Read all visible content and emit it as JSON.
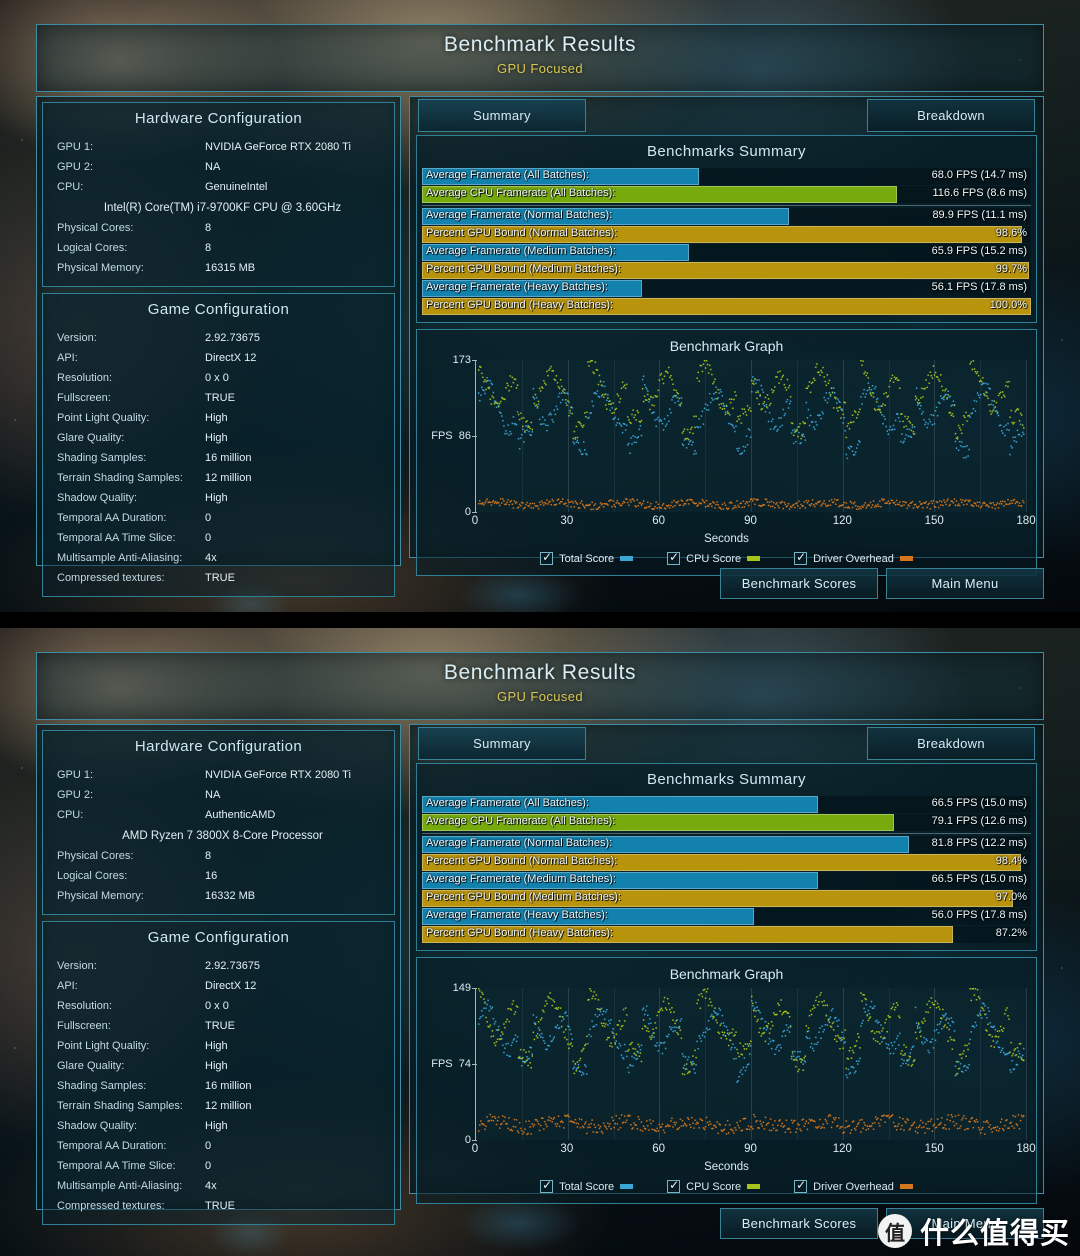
{
  "screens": [
    {
      "id": "intel",
      "header": {
        "title": "Benchmark Results",
        "subtitle": "GPU Focused"
      },
      "tabs": [
        {
          "label": "Summary",
          "active": true
        },
        {
          "label": "Breakdown",
          "active": false
        }
      ],
      "hardware": {
        "heading": "Hardware Configuration",
        "rows": [
          {
            "key": "GPU 1:",
            "value": "NVIDIA GeForce RTX 2080 Ti"
          },
          {
            "key": "GPU 2:",
            "value": "NA"
          },
          {
            "key": "CPU:",
            "value": "GenuineIntel"
          },
          {
            "key": "",
            "value": "Intel(R) Core(TM) i7-9700KF CPU @ 3.60GHz",
            "full": true
          },
          {
            "key": "Physical Cores:",
            "value": "8"
          },
          {
            "key": "Logical Cores:",
            "value": "8"
          },
          {
            "key": "Physical Memory:",
            "value": "16315  MB"
          }
        ]
      },
      "game": {
        "heading": "Game Configuration",
        "rows": [
          {
            "key": "Version:",
            "value": "2.92.73675"
          },
          {
            "key": "API:",
            "value": "DirectX 12"
          },
          {
            "key": "Resolution:",
            "value": "0 x 0"
          },
          {
            "key": "Fullscreen:",
            "value": "TRUE"
          },
          {
            "key": "Point Light Quality:",
            "value": "High"
          },
          {
            "key": "Glare Quality:",
            "value": "High"
          },
          {
            "key": "Shading Samples:",
            "value": "16 million"
          },
          {
            "key": "Terrain Shading Samples:",
            "value": "12 million"
          },
          {
            "key": "Shadow Quality:",
            "value": "High"
          },
          {
            "key": "Temporal AA Duration:",
            "value": "0"
          },
          {
            "key": "Temporal AA Time Slice:",
            "value": "0"
          },
          {
            "key": "Multisample Anti-Aliasing:",
            "value": "4x"
          },
          {
            "key": "Compressed textures:",
            "value": "TRUE"
          }
        ]
      },
      "summary": {
        "heading": "Benchmarks Summary",
        "bars": [
          {
            "label": "Average Framerate (All Batches):",
            "value": "68.0 FPS (14.7 ms)",
            "pct": 45.5,
            "color": "#1281ad"
          },
          {
            "label": "Average CPU Framerate (All Batches):",
            "value": "116.6 FPS (8.6 ms)",
            "pct": 78.0,
            "color": "#77ab0d"
          },
          {
            "separator": true
          },
          {
            "label": "Average Framerate (Normal Batches):",
            "value": "89.9 FPS (11.1 ms)",
            "pct": 60.2,
            "color": "#1281ad"
          },
          {
            "label": "Percent GPU Bound (Normal Batches):",
            "value": "98.6%",
            "pct": 98.6,
            "color": "#b8930c"
          },
          {
            "label": "Average Framerate (Medium Batches):",
            "value": "65.9 FPS (15.2 ms)",
            "pct": 43.9,
            "color": "#1281ad"
          },
          {
            "label": "Percent GPU Bound (Medium Batches):",
            "value": "99.7%",
            "pct": 99.7,
            "color": "#b8930c"
          },
          {
            "label": "Average Framerate (Heavy Batches):",
            "value": "56.1 FPS (17.8 ms)",
            "pct": 36.2,
            "color": "#1281ad"
          },
          {
            "label": "Percent GPU Bound (Heavy Batches):",
            "value": "100.0%",
            "pct": 100.0,
            "color": "#b8930c"
          }
        ]
      },
      "graph": {
        "title": "Benchmark Graph",
        "ylabel": "FPS",
        "yticks": [
          "173",
          "86",
          "0"
        ],
        "xlabel": "Seconds",
        "xticks": [
          "0",
          "30",
          "60",
          "90",
          "120",
          "150",
          "180"
        ],
        "legend": [
          {
            "label": "Total Score",
            "color": "#3aa6d8",
            "checked": true
          },
          {
            "label": "CPU Score",
            "color": "#a8c41a",
            "checked": true
          },
          {
            "label": "Driver Overhead",
            "color": "#d4761c",
            "checked": true
          }
        ]
      },
      "buttons": [
        {
          "label": "Benchmark Scores"
        },
        {
          "label": "Main Menu"
        }
      ],
      "chart_data": {
        "type": "scatter",
        "title": "Benchmark Graph",
        "xlabel": "Seconds",
        "ylabel": "FPS",
        "xlim": [
          0,
          183
        ],
        "ylim": [
          0,
          173
        ],
        "yticks": [
          0,
          86,
          173
        ],
        "xticks": [
          0,
          30,
          60,
          90,
          120,
          150,
          180
        ],
        "grid": "vertical",
        "legend_position": "bottom",
        "series": [
          {
            "name": "Total Score",
            "color": "#3aa6d8",
            "mean": 68.0,
            "min": 38,
            "max": 150
          },
          {
            "name": "CPU Score",
            "color": "#a8c41a",
            "mean": 116.6,
            "min": 60,
            "max": 172
          },
          {
            "name": "Driver Overhead",
            "color": "#d4761c",
            "mean": 10,
            "min": 2,
            "max": 26
          }
        ]
      }
    },
    {
      "id": "amd",
      "header": {
        "title": "Benchmark Results",
        "subtitle": "GPU Focused"
      },
      "tabs": [
        {
          "label": "Summary",
          "active": true
        },
        {
          "label": "Breakdown",
          "active": false
        }
      ],
      "hardware": {
        "heading": "Hardware Configuration",
        "rows": [
          {
            "key": "GPU 1:",
            "value": "NVIDIA GeForce RTX 2080 Ti"
          },
          {
            "key": "GPU 2:",
            "value": "NA"
          },
          {
            "key": "CPU:",
            "value": "AuthenticAMD"
          },
          {
            "key": "",
            "value": "AMD Ryzen 7 3800X 8-Core Processor",
            "full": true
          },
          {
            "key": "Physical Cores:",
            "value": "8"
          },
          {
            "key": "Logical Cores:",
            "value": "16"
          },
          {
            "key": "Physical Memory:",
            "value": "16332  MB"
          }
        ]
      },
      "game": {
        "heading": "Game Configuration",
        "rows": [
          {
            "key": "Version:",
            "value": "2.92.73675"
          },
          {
            "key": "API:",
            "value": "DirectX 12"
          },
          {
            "key": "Resolution:",
            "value": "0 x 0"
          },
          {
            "key": "Fullscreen:",
            "value": "TRUE"
          },
          {
            "key": "Point Light Quality:",
            "value": "High"
          },
          {
            "key": "Glare Quality:",
            "value": "High"
          },
          {
            "key": "Shading Samples:",
            "value": "16 million"
          },
          {
            "key": "Terrain Shading Samples:",
            "value": "12 million"
          },
          {
            "key": "Shadow Quality:",
            "value": "High"
          },
          {
            "key": "Temporal AA Duration:",
            "value": "0"
          },
          {
            "key": "Temporal AA Time Slice:",
            "value": "0"
          },
          {
            "key": "Multisample Anti-Aliasing:",
            "value": "4x"
          },
          {
            "key": "Compressed textures:",
            "value": "TRUE"
          }
        ]
      },
      "summary": {
        "heading": "Benchmarks Summary",
        "bars": [
          {
            "label": "Average Framerate (All Batches):",
            "value": "66.5 FPS (15.0 ms)",
            "pct": 65.0,
            "color": "#1281ad"
          },
          {
            "label": "Average CPU Framerate (All Batches):",
            "value": "79.1 FPS (12.6 ms)",
            "pct": 77.5,
            "color": "#77ab0d"
          },
          {
            "separator": true
          },
          {
            "label": "Average Framerate (Normal Batches):",
            "value": "81.8 FPS (12.2 ms)",
            "pct": 80.0,
            "color": "#1281ad"
          },
          {
            "label": "Percent GPU Bound (Normal Batches):",
            "value": "98.4%",
            "pct": 98.4,
            "color": "#b8930c"
          },
          {
            "label": "Average Framerate (Medium Batches):",
            "value": "66.5 FPS (15.0 ms)",
            "pct": 65.0,
            "color": "#1281ad"
          },
          {
            "label": "Percent GPU Bound (Medium Batches):",
            "value": "97.0%",
            "pct": 97.0,
            "color": "#b8930c"
          },
          {
            "label": "Average Framerate (Heavy Batches):",
            "value": "56.0 FPS (17.8 ms)",
            "pct": 54.5,
            "color": "#1281ad"
          },
          {
            "label": "Percent GPU Bound (Heavy Batches):",
            "value": "87.2%",
            "pct": 87.2,
            "color": "#b8930c"
          }
        ]
      },
      "graph": {
        "title": "Benchmark Graph",
        "ylabel": "FPS",
        "yticks": [
          "149",
          "74",
          "0"
        ],
        "xlabel": "Seconds",
        "xticks": [
          "0",
          "30",
          "60",
          "90",
          "120",
          "150",
          "180"
        ],
        "legend": [
          {
            "label": "Total Score",
            "color": "#3aa6d8",
            "checked": true
          },
          {
            "label": "CPU Score",
            "color": "#a8c41a",
            "checked": true
          },
          {
            "label": "Driver Overhead",
            "color": "#d4761c",
            "checked": true
          }
        ]
      },
      "buttons": [
        {
          "label": "Benchmark Scores"
        },
        {
          "label": "Main Menu"
        }
      ],
      "chart_data": {
        "type": "scatter",
        "title": "Benchmark Graph",
        "xlabel": "Seconds",
        "ylabel": "FPS",
        "xlim": [
          0,
          183
        ],
        "ylim": [
          0,
          149
        ],
        "yticks": [
          0,
          74,
          149
        ],
        "xticks": [
          0,
          30,
          60,
          90,
          120,
          150,
          180
        ],
        "grid": "vertical",
        "legend_position": "bottom",
        "series": [
          {
            "name": "Total Score",
            "color": "#3aa6d8",
            "mean": 66.5,
            "min": 40,
            "max": 135
          },
          {
            "name": "CPU Score",
            "color": "#a8c41a",
            "mean": 79.1,
            "min": 45,
            "max": 148
          },
          {
            "name": "Driver Overhead",
            "color": "#d4761c",
            "mean": 16,
            "min": 5,
            "max": 34
          }
        ]
      }
    }
  ],
  "watermark": {
    "logo": "值",
    "text": "什么值得买"
  }
}
